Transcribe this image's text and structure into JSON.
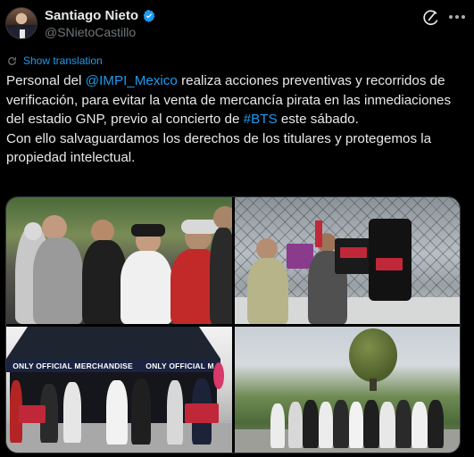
{
  "author": {
    "name": "Santiago Nieto",
    "handle": "@SNietoCastillo",
    "verified_color": "#1d9bf0"
  },
  "header": {
    "grok_icon": "grok-icon",
    "more_icon": "more-icon"
  },
  "translate": {
    "label": "Show translation",
    "icon": "translate-icon"
  },
  "tweet": {
    "line1_prefix": "Personal del ",
    "mention": "@IMPI_Mexico",
    "line1_suffix": " realiza acciones preventivas y recorridos de verificación, para evitar la venta de mercancía pirata en las inmediaciones del estadio GNP, previo al concierto de ",
    "hashtag": "#BTS",
    "line1_end": " este sábado.",
    "line2": "Con ello salvaguardamos los derechos de los titulares y protegemos la propiedad intelectual."
  },
  "media": {
    "tent_banner_left": "ONLY OFFICIAL MERCHANDISE",
    "tent_banner_right": "ONLY OFFICIAL M"
  },
  "colors": {
    "background": "#000000",
    "text": "#e7e9ea",
    "secondary": "#71767b",
    "accent": "#1d9bf0"
  }
}
